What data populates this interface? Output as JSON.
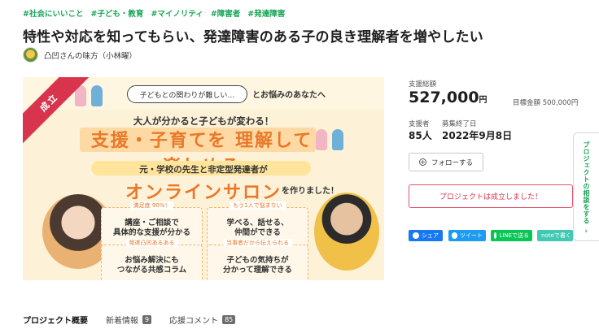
{
  "tags": [
    "#社会にいいこと",
    "#子ども・教育",
    "#マイノリティ",
    "#障害者",
    "#発達障害"
  ],
  "title": "特性や対応を知ってもらい、発達障害のある子の良き理解者を増やしたい",
  "owner": {
    "name": "凸凹さんの味方（小林曜）"
  },
  "hero": {
    "ribbon": "成立",
    "bubble": "子どもとの関わりが難しい…",
    "bubble_after": "とお悩みのあなたへ",
    "lead": "大人が分かると子どもが変わる！",
    "headline": "支援・子育てを 理解して 楽しめる",
    "sub": "元・学校の先生と非定型発達者が",
    "salon": "オンラインサロン",
    "salon_small": "を作りました！",
    "cards": [
      {
        "badge": "満足度 90%！",
        "body": "講座・ご相談で\n具体的な支援が分かる"
      },
      {
        "badge": "もう1人で悩まない",
        "body": "学べる、話せる、\n仲間ができる"
      },
      {
        "badge": "発達凸凹あるある",
        "body": "お悩み解決にも\nつながる共感コラム"
      },
      {
        "badge": "当事者だから伝えられる",
        "body": "子どもの気持ちが\n分かって理解できる"
      }
    ]
  },
  "stats": {
    "total_label": "支援総額",
    "total_value": "527,000",
    "total_unit": "円",
    "goal_label": "目標金額",
    "goal_value": "500,000円",
    "supporters_label": "支援者",
    "supporters_value": "85人",
    "end_label": "募集終了日",
    "end_value": "2022年9月8日"
  },
  "follow_label": "フォローする",
  "success_message": "プロジェクトは成立しました！",
  "share": {
    "facebook": "シェア",
    "twitter": "ツイート",
    "line": "LINEで送る",
    "note": "noteで書く"
  },
  "side_tab": "プロジェクトの相談をする",
  "tabs": [
    {
      "label": "プロジェクト概要",
      "count": ""
    },
    {
      "label": "新着情報",
      "count": "9"
    },
    {
      "label": "応援コメント",
      "count": "85"
    }
  ],
  "colors": {
    "accent_green": "#18a558",
    "accent_red": "#d9344d",
    "hero_orange": "#e8782a",
    "facebook": "#1877f2",
    "twitter": "#1d9bf0",
    "line": "#06c755",
    "note": "#41c9b4"
  }
}
